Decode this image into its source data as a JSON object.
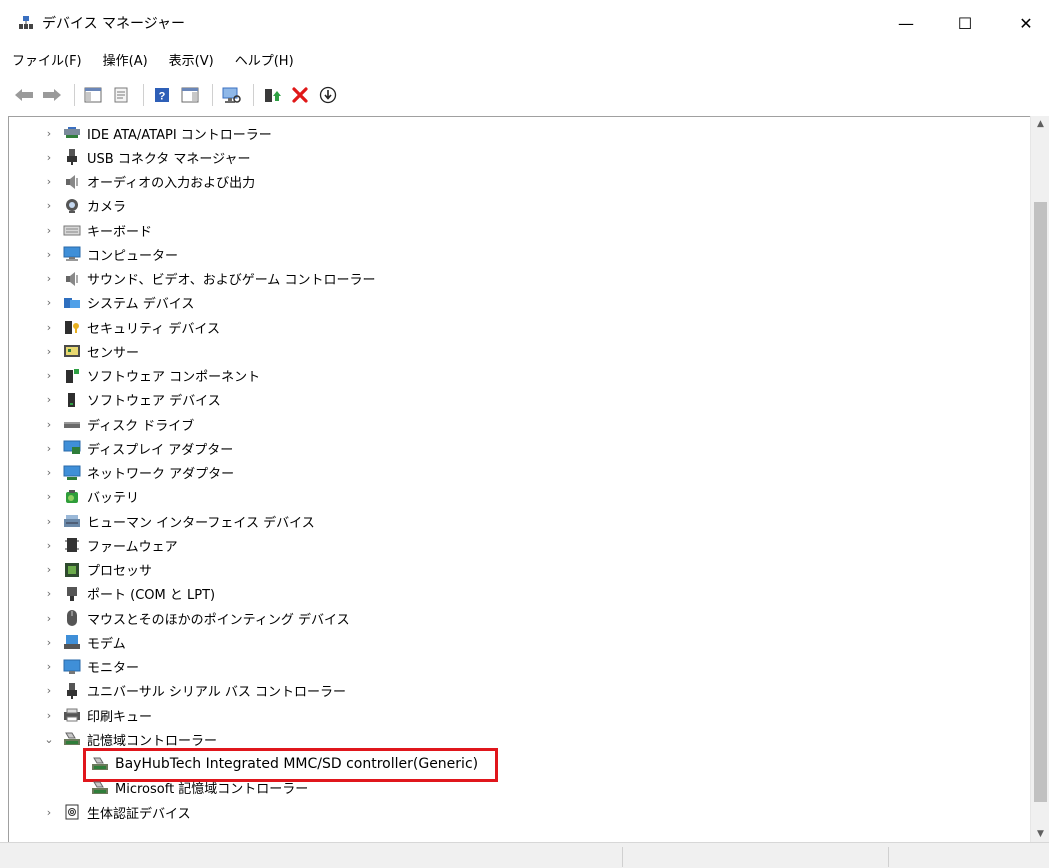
{
  "window": {
    "title": "デバイス マネージャー",
    "min_glyph": "—",
    "max_glyph": "☐",
    "close_glyph": "✕"
  },
  "menu": [
    "ファイル(F)",
    "操作(A)",
    "表示(V)",
    "ヘルプ(H)"
  ],
  "toolbar": {
    "buttons": [
      "back-icon",
      "forward-icon",
      "show-hide-console-tree-icon",
      "properties-icon",
      "help-icon",
      "action-pane-icon",
      "scan-hardware-icon",
      "update-driver-icon",
      "uninstall-device-icon",
      "disable-device-icon"
    ]
  },
  "tree": {
    "categories": [
      {
        "label": "IDE ATA/ATAPI コントローラー",
        "icon": "ide-controller-icon"
      },
      {
        "label": "USB コネクタ マネージャー",
        "icon": "usb-connector-icon"
      },
      {
        "label": "オーディオの入力および出力",
        "icon": "audio-icon"
      },
      {
        "label": "カメラ",
        "icon": "camera-icon"
      },
      {
        "label": "キーボード",
        "icon": "keyboard-icon"
      },
      {
        "label": "コンピューター",
        "icon": "computer-icon"
      },
      {
        "label": "サウンド、ビデオ、およびゲーム コントローラー",
        "icon": "sound-icon"
      },
      {
        "label": "システム デバイス",
        "icon": "system-device-icon"
      },
      {
        "label": "セキュリティ デバイス",
        "icon": "security-device-icon"
      },
      {
        "label": "センサー",
        "icon": "sensor-icon"
      },
      {
        "label": "ソフトウェア コンポーネント",
        "icon": "software-component-icon"
      },
      {
        "label": "ソフトウェア デバイス",
        "icon": "software-device-icon"
      },
      {
        "label": "ディスク ドライブ",
        "icon": "disk-drive-icon"
      },
      {
        "label": "ディスプレイ アダプター",
        "icon": "display-adapter-icon"
      },
      {
        "label": "ネットワーク アダプター",
        "icon": "network-adapter-icon"
      },
      {
        "label": "バッテリ",
        "icon": "battery-icon"
      },
      {
        "label": "ヒューマン インターフェイス デバイス",
        "icon": "hid-icon"
      },
      {
        "label": "ファームウェア",
        "icon": "firmware-icon"
      },
      {
        "label": "プロセッサ",
        "icon": "processor-icon"
      },
      {
        "label": "ポート (COM と LPT)",
        "icon": "port-icon"
      },
      {
        "label": "マウスとそのほかのポインティング デバイス",
        "icon": "mouse-icon"
      },
      {
        "label": "モデム",
        "icon": "modem-icon"
      },
      {
        "label": "モニター",
        "icon": "monitor-icon"
      },
      {
        "label": "ユニバーサル シリアル バス コントローラー",
        "icon": "usb-controller-icon"
      },
      {
        "label": "印刷キュー",
        "icon": "print-queue-icon"
      },
      {
        "label": "記憶域コントローラー",
        "icon": "storage-controller-icon",
        "expanded": true
      },
      {
        "label": "BayHubTech Integrated MMC/SD controller(Generic)",
        "icon": "storage-controller-icon",
        "child": true,
        "selected": true
      },
      {
        "label": "Microsoft 記憶域コントローラー",
        "icon": "storage-controller-icon",
        "child": true
      },
      {
        "label": "生体認証デバイス",
        "icon": "biometric-icon"
      }
    ],
    "collapsed_glyph": "›",
    "expanded_glyph": "⌄"
  },
  "colors": {
    "highlight_border": "#e0161c",
    "background": "#ffffff",
    "statusbar": "#f0f0f0"
  }
}
